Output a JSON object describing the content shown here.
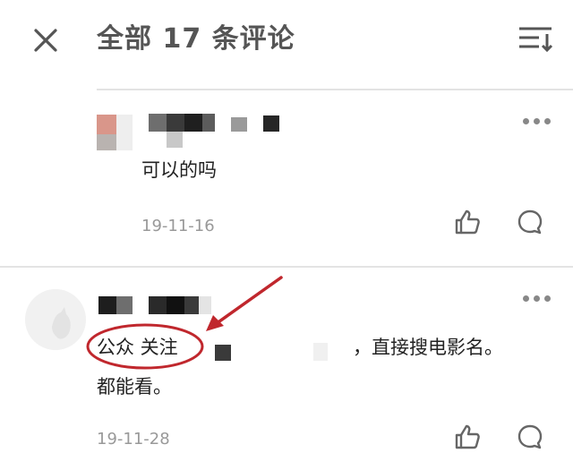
{
  "header": {
    "title": "全部 17 条评论",
    "close_icon": "close-icon",
    "sort_icon": "sort-icon"
  },
  "comments": [
    {
      "username": "",
      "avatar": "pixelated-avatar",
      "text": "可以的吗",
      "date": "19-11-16"
    },
    {
      "username": "",
      "avatar": "default-cat-avatar",
      "text_line1_prefix": "公众 关注",
      "text_line1_suffix": "，直接搜电影名。",
      "text_line2": "都能看。",
      "date": "19-11-28"
    }
  ],
  "colors": {
    "annotation": "#c0272d",
    "date": "#999999",
    "divider": "#e3e3e3"
  }
}
